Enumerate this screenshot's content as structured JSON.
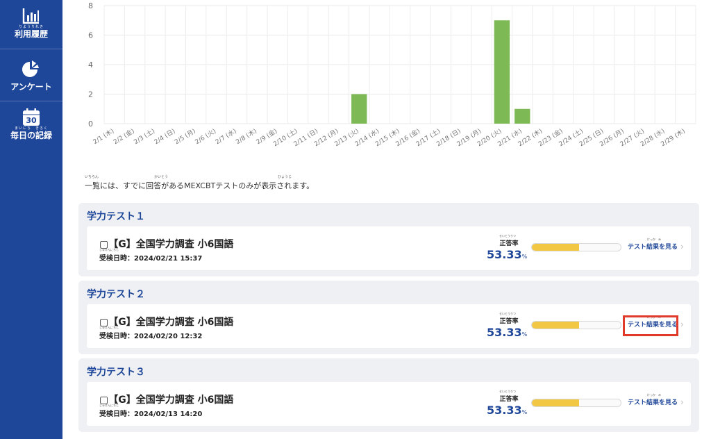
{
  "sidebar": {
    "items": [
      {
        "label": "利用履歴",
        "ruby": "りようりれき",
        "icon": "bar-chart-icon"
      },
      {
        "label": "アンケート",
        "ruby": "",
        "icon": "pie-chart-icon"
      },
      {
        "label": "毎日の記録",
        "ruby": "まいにち　きろく",
        "icon": "calendar-icon",
        "icon_text": "30"
      }
    ]
  },
  "chart_data": {
    "type": "bar",
    "categories": [
      "2/1 (木)",
      "2/2 (金)",
      "2/3 (土)",
      "2/4 (日)",
      "2/5 (月)",
      "2/6 (火)",
      "2/7 (水)",
      "2/8 (木)",
      "2/9 (金)",
      "2/10 (土)",
      "2/11 (日)",
      "2/12 (月)",
      "2/13 (火)",
      "2/14 (水)",
      "2/15 (木)",
      "2/16 (金)",
      "2/17 (土)",
      "2/18 (日)",
      "2/19 (月)",
      "2/20 (火)",
      "2/21 (水)",
      "2/22 (木)",
      "2/23 (金)",
      "2/24 (土)",
      "2/25 (日)",
      "2/26 (月)",
      "2/27 (火)",
      "2/28 (水)",
      "2/29 (木)"
    ],
    "values": [
      0,
      0,
      0,
      0,
      0,
      0,
      0,
      0,
      0,
      0,
      0,
      0,
      2,
      0,
      0,
      0,
      0,
      0,
      0,
      7,
      1,
      0,
      0,
      0,
      0,
      0,
      0,
      0,
      0
    ],
    "yticks": [
      "0",
      "2",
      "4",
      "6",
      "8"
    ],
    "ylim": [
      0,
      8
    ],
    "bar_color": "#7dba56",
    "grid": true
  },
  "note": {
    "text": "一覧には、すでに回答があるMEXCBTテストのみが表示されます。",
    "ruby_1": "いちらん",
    "ruby_2": "かいとう",
    "ruby_3": "ひょうじ"
  },
  "labels": {
    "rate_label": "正答率",
    "rate_ruby": "せいとうりつ",
    "date_ruby": "じゅけんにちじ",
    "link_ruby": "けっか　み",
    "link_label": "テスト結果を見る",
    "chevron": "›",
    "percent": "%"
  },
  "panels": [
    {
      "title": "学力テスト１",
      "card": {
        "title": "【G】全国学力調査 小6国語",
        "date": "受検日時：2024/02/21 15:37",
        "rate": "53.33",
        "progress": 0.5333
      }
    },
    {
      "title": "学力テスト２",
      "card": {
        "title": "【G】全国学力調査 小6国語",
        "date": "受検日時：2024/02/20 12:32",
        "rate": "53.33",
        "progress": 0.5333
      }
    },
    {
      "title": "学力テスト３",
      "card": {
        "title": "【G】全国学力調査 小6国語",
        "date": "受検日時：2024/02/13 14:20",
        "rate": "53.33",
        "progress": 0.5333
      }
    }
  ],
  "colors": {
    "accent": "#1f4799",
    "highlight": "#e03a2a",
    "progress": "#f2c744"
  }
}
